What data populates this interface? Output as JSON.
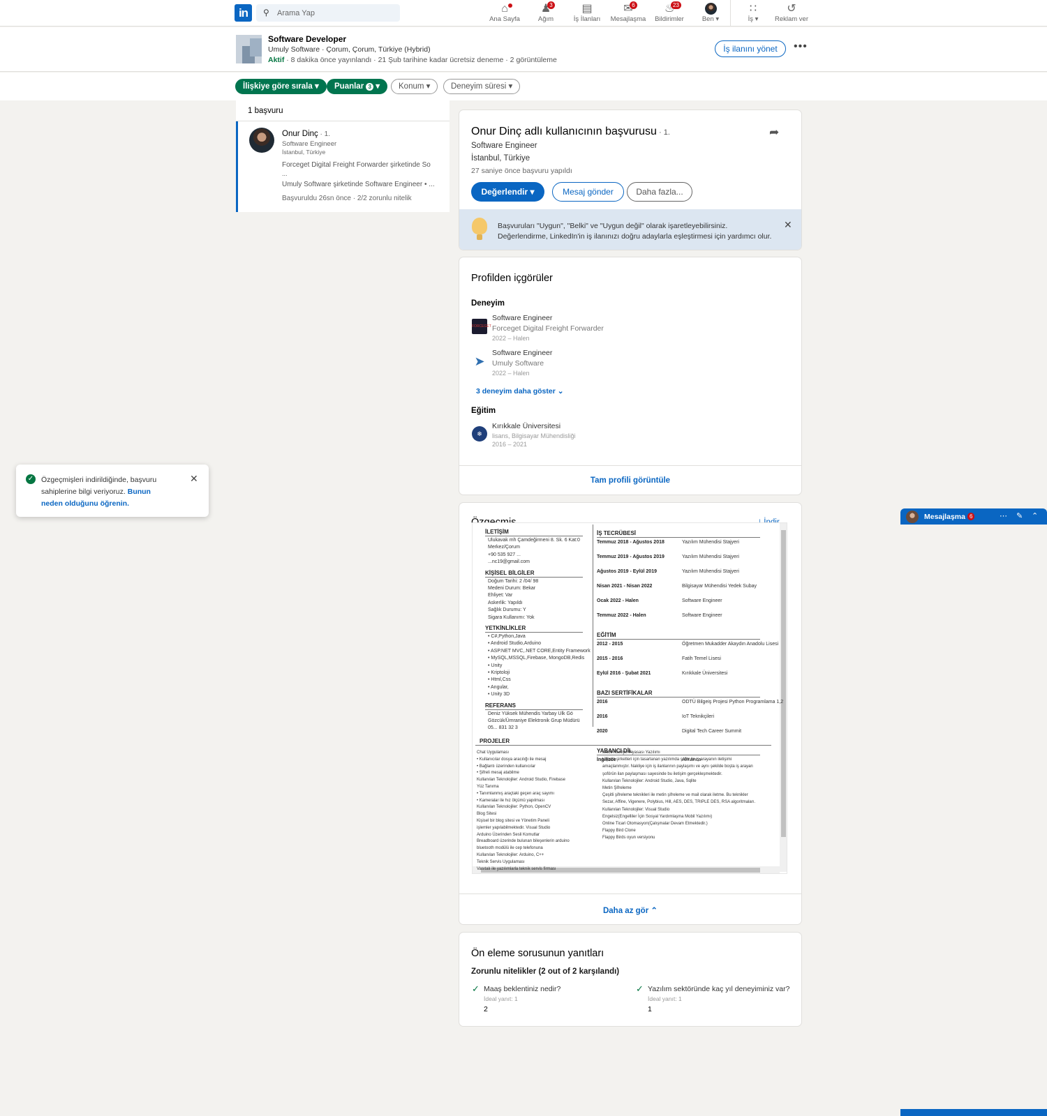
{
  "nav": {
    "logo": "in",
    "search_placeholder": "Arama Yap",
    "items": [
      {
        "label": "Ana Sayfa",
        "icon": "home-icon",
        "badge": ""
      },
      {
        "label": "Ağım",
        "icon": "network-icon",
        "badge": "3"
      },
      {
        "label": "İş İlanları",
        "icon": "briefcase-icon",
        "badge": ""
      },
      {
        "label": "Mesajlaşma",
        "icon": "messaging-icon",
        "badge": "6"
      },
      {
        "label": "Bildirimler",
        "icon": "bell-icon",
        "badge": "23"
      },
      {
        "label": "Ben ▾",
        "icon": "avatar",
        "badge": ""
      },
      {
        "label": "İş ▾",
        "icon": "grid-icon",
        "badge": ""
      },
      {
        "label": "Reklam ver",
        "icon": "compass-icon",
        "badge": ""
      }
    ]
  },
  "job": {
    "title": "Software Developer",
    "subtitle": "Umuly Software · Çorum, Çorum, Türkiye (Hybrid)",
    "status": "Aktif",
    "meta": " · 8 dakika önce yayınlandı · 21 Şub tarihine kadar ücretsiz deneme · 2 görüntüleme",
    "manage_label": "İş ilanını yönet",
    "more": "•••"
  },
  "filters": {
    "sort_label": "İlişkiye göre sırala",
    "ratings_label": "Puanlar",
    "ratings_count": "3",
    "location_label": "Konum",
    "experience_label": "Deneyim süresi"
  },
  "applicants": {
    "count_label": "1 başvuru",
    "items": [
      {
        "name": "Onur Dinç",
        "degree": " · 1.",
        "headline": "Software Engineer",
        "location": "İstanbul, Türkiye",
        "exp1": "Forceget Digital Freight Forwarder şirketinde So",
        "exp1b": "...",
        "exp2": "Umuly Software şirketinde Software Engineer • ...",
        "applied": "Başvuruldu 26sn önce · 2/2 zorunlu nitelik"
      }
    ]
  },
  "detail": {
    "title": "Onur Dinç adlı kullanıcının başvurusu",
    "degree": " · 1.",
    "headline": "Software Engineer",
    "location": "İstanbul, Türkiye",
    "applied": "27 saniye önce başvuru yapıldı",
    "rate_label": "Değerlendir",
    "message_label": "Mesaj gönder",
    "more_label": "Daha fazla...",
    "tip": "Başvuruları \"Uygun\", \"Belki\" ve \"Uygun değil\" olarak işaretleyebilirsiniz. Değerlendirme, LinkedIn'in iş ilanınızı doğru adaylarla eşleştirmesi için yardımcı olur."
  },
  "insights": {
    "title": "Profilden içgörüler",
    "experience_heading": "Deneyim",
    "experiences": [
      {
        "title": "Software Engineer",
        "company": "Forceget Digital Freight Forwarder",
        "dates": "2022 – Halen"
      },
      {
        "title": "Software Engineer",
        "company": "Umuly Software",
        "dates": "2022 – Halen"
      }
    ],
    "show_more": "3 deneyim daha göster",
    "education_heading": "Eğitim",
    "education": {
      "school": "Kırıkkale Üniversitesi",
      "degree": "lisans, Bilgisayar Mühendisliği",
      "dates": "2016 – 2021"
    },
    "full_profile": "Tam profili görüntüle"
  },
  "resume": {
    "title": "Özgeçmiş",
    "download": "İndir",
    "show_less": "Daha az gör",
    "left": [
      {
        "t": "h",
        "v": "İLETİŞİM"
      },
      {
        "t": "p",
        "v": "Ulukavak mh Çamdeğirmeni 8. Sk. 6 Kat:0"
      },
      {
        "t": "p",
        "v": "Merkez/Çorum"
      },
      {
        "t": "p",
        "v": "+90 535 927 ..."
      },
      {
        "t": "p",
        "v": "...nc19@gmail.com"
      },
      {
        "t": "h",
        "v": "KİŞİSEL BİLGİLER"
      },
      {
        "t": "p",
        "v": "Doğum Tarihi: 2 /04/ 98"
      },
      {
        "t": "p",
        "v": "Medeni Durum: Bekar"
      },
      {
        "t": "p",
        "v": "Ehliyet: Var"
      },
      {
        "t": "p",
        "v": "Askerlik: Yapıldı"
      },
      {
        "t": "p",
        "v": "Sağlık Durumu: Y"
      },
      {
        "t": "p",
        "v": "Sigara Kullanımı: Yok"
      },
      {
        "t": "h",
        "v": "YETKİNLİKLER"
      },
      {
        "t": "p",
        "v": "• C#,Python,Java"
      },
      {
        "t": "p",
        "v": "• Android Studio,Arduino"
      },
      {
        "t": "p",
        "v": "• ASP.NET MVC,.NET CORE,Entity Framework"
      },
      {
        "t": "p",
        "v": "• MySQL,MSSQL,Firebase, MongoDB,Redis"
      },
      {
        "t": "p",
        "v": "• Unity"
      },
      {
        "t": "p",
        "v": "• Kriptoloji"
      },
      {
        "t": "p",
        "v": "• Html,Css"
      },
      {
        "t": "p",
        "v": "• Angular,"
      },
      {
        "t": "p",
        "v": "• Unity 3D"
      },
      {
        "t": "h",
        "v": "REFERANS"
      },
      {
        "t": "p",
        "v": "Deniz Yüksek Mühendis Yarbay Ulk Gö"
      },
      {
        "t": "p",
        "v": "Gözcük/Ümraniye Elektronik Grup Müdürü"
      },
      {
        "t": "p",
        "v": "05... 831 32 3"
      }
    ],
    "right": [
      {
        "t": "h",
        "v": "İŞ TECRÜBESİ"
      },
      {
        "t": "r",
        "a": "Temmuz 2018 - Ağustos 2018",
        "b": "Yazılım Mühendisi Stajyeri"
      },
      {
        "t": "r",
        "a": "Temmuz 2019 - Ağustos 2019",
        "b": "Yazılım Mühendisi Stajyeri"
      },
      {
        "t": "r",
        "a": "Ağustos 2019 - Eylül 2019",
        "b": "Yazılım Mühendisi Stajyeri"
      },
      {
        "t": "r",
        "a": "Nisan 2021 - Nisan 2022",
        "b": "Bilgisayar Mühendisi Yedek Subay"
      },
      {
        "t": "r",
        "a": "Ocak 2022 - Halen",
        "b": "Software Engineer"
      },
      {
        "t": "r",
        "a": "Temmuz 2022 - Halen",
        "b": "Software Engineer"
      },
      {
        "t": "h",
        "v": "EĞİTİM"
      },
      {
        "t": "r",
        "a": "2012 - 2015",
        "b": "Öğretmen Mukadder Akaydın Anadolu Lisesi"
      },
      {
        "t": "r",
        "a": "2015 - 2016",
        "b": "Fatih Temel Lisesi"
      },
      {
        "t": "r",
        "a": "Eylül 2016 - Şubat 2021",
        "b": "Kırıkkale Üniversitesi"
      },
      {
        "t": "h",
        "v": "BAZI SERTİFİKALAR"
      },
      {
        "t": "r",
        "a": "2016",
        "b": "ODTÜ Bilgeiş Projesi Python Programlama 1,2"
      },
      {
        "t": "r",
        "a": "2016",
        "b": "IoT Teknikçileri"
      },
      {
        "t": "r",
        "a": "2020",
        "b": "Digital Tech Career Summit"
      },
      {
        "t": "h",
        "v": "YABANCI DİL"
      },
      {
        "t": "r",
        "a": "İngilizce",
        "b": "Almanca"
      }
    ],
    "projects_heading": "PROJELER",
    "projects_left": [
      "Chat Uygulaması",
      "• Kullanıcılar dosya aracılığı ile mesaj",
      "• Bağlantı üzerinden kullanıcılar",
      "• Şifreli mesaj atabilme",
      "Kullanılan Teknolojiler: Android Studio, Firebase",
      "Yüz Tanıma",
      "• Tanımlanmış araçtaki geçen araç sayımı",
      "• Kameralar ile hız ölçümü yapılması",
      "Kullanılan Teknolojiler: Python, OpenCV",
      "Blog Sitesi",
      "Kişisel bir blog sitesi ve Yönetim Paneli",
      "işlemler yapılabilmektedir. Visual Studio",
      "Arduino Üzerinden Sesli Komutlar",
      "Breadboard üzerinde bulunan bileşenlerin arduino",
      "bluetooth modülü ile cep telefonuna",
      "Kullanılan Teknolojiler: Arduino, C++",
      "Teknik Servis Uygulaması",
      "Vasıtalı ile yazılımlarla teknik servis firması"
    ],
    "projects_right": [
      "Mobil Nakliye Piyasası Yazılımı",
      "Lojistik şirketleri için tasarlanan yazılımda şoför ile iş arayanın iletişimi",
      "amaçlanmıştır. Nakliye için iş ilanlarının paylaşımı ve aynı şekilde boşta iş arayan",
      "şoförün ilan paylaşması sayesinde bu iletişim gerçekleşmektedir.",
      "Kullanılan Teknolojiler: Android Studio, Java, Sqlite",
      "Metin Şifreleme",
      "Çeşitli şifreleme teknikleri ile metin şifreleme ve mail olarak iletme. Bu teknikler",
      "Sezar, Affine, Vigenere, Polybius, Hill, AES, DES, TRIPLE DES, RSA algoritmaları.",
      "Kullanılan Teknolojiler: Visual Studio",
      "Engelsiz(Engelliler İçin Sosyal Yardımlaşma Mobil Yazılımı)",
      "Online Ticari Otomasyon(Çalışmalar Devam Etmektedir.)",
      "Flappy Bird Clone",
      "Flappy Birds oyun versiyonu"
    ]
  },
  "screening": {
    "title": "Ön eleme sorusunun yanıtları",
    "subtitle": "Zorunlu nitelikler (2 out of 2 karşılandı)",
    "questions": [
      {
        "q": "Maaş beklentiniz nedir?",
        "ideal": "İdeal yanıt: 1",
        "answer": "2"
      },
      {
        "q": "Yazılım sektöründe kaç yıl deneyiminiz var?",
        "ideal": "İdeal yanıt: 1",
        "answer": "1"
      }
    ]
  },
  "toast": {
    "text": "Özgeçmişleri indirildiğinde, başvuru sahiplerine bilgi veriyoruz. ",
    "link": "Bunun neden olduğunu öğrenin."
  },
  "messaging": {
    "label": "Mesajlaşma",
    "badge": "6"
  },
  "colors": {
    "brand": "#0a66c2",
    "green": "#01754f",
    "badge": "#cc1016",
    "background": "#f3f2ef"
  }
}
